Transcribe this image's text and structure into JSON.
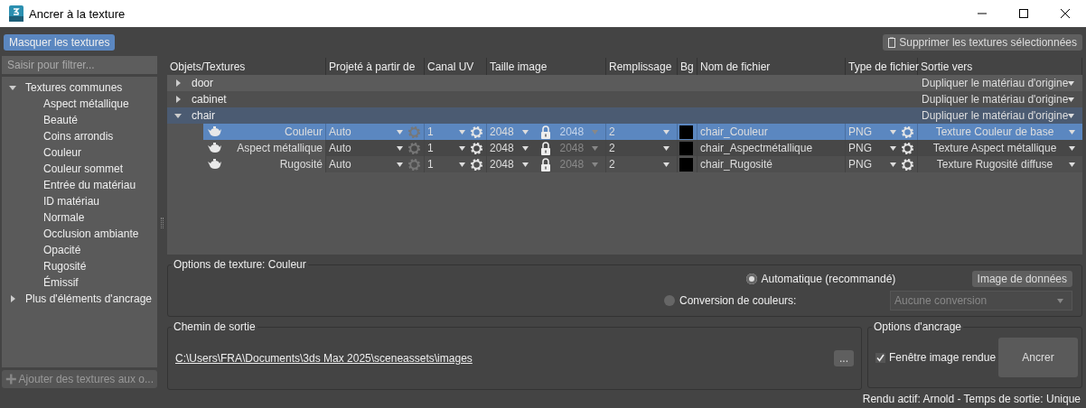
{
  "window": {
    "title": "Ancrer à la texture"
  },
  "toolbar": {
    "hide_button": "Masquer les textures",
    "remove_button": "Supprimer les textures sélectionnées"
  },
  "sidebar": {
    "filter_placeholder": "Saisir pour filtrer...",
    "tree": [
      {
        "label": "Textures communes",
        "expanded": true,
        "children": [
          {
            "label": "Aspect métallique"
          },
          {
            "label": "Beauté"
          },
          {
            "label": "Coins arrondis"
          },
          {
            "label": "Couleur"
          },
          {
            "label": "Couleur sommet"
          },
          {
            "label": "Entrée du matériau"
          },
          {
            "label": "ID matériau"
          },
          {
            "label": "Normale"
          },
          {
            "label": "Occlusion ambiante"
          },
          {
            "label": "Opacité"
          },
          {
            "label": "Rugosité"
          },
          {
            "label": "Émissif"
          }
        ]
      },
      {
        "label": "Plus d'éléments d'ancrage",
        "expanded": false
      }
    ],
    "add_button": {
      "label": "Ajouter des textures aux o...",
      "disabled": true
    }
  },
  "table": {
    "columns": [
      "Objets/Textures",
      "Projeté à partir de",
      "Canal UV",
      "Taille image",
      "Remplissage",
      "Bg",
      "Nom de fichier",
      "Type de fichier",
      "Sortie vers"
    ],
    "rows": [
      {
        "name": "door",
        "expanded": false,
        "selected": false,
        "output": "Dupliquer le matériau d'origine",
        "children": []
      },
      {
        "name": "cabinet",
        "expanded": false,
        "selected": false,
        "output": "Dupliquer le matériau d'origine",
        "children": []
      },
      {
        "name": "chair",
        "expanded": true,
        "selected": true,
        "output": "Dupliquer le matériau d'origine",
        "children": [
          {
            "name": "Couleur",
            "selected": true,
            "projected": "Auto",
            "uv": "1",
            "size": "2048",
            "size_locked": "2048",
            "fill": "2",
            "color": "#000000",
            "filename": "chair_Couleur",
            "filetype": "PNG",
            "output": "Texture Couleur de base"
          },
          {
            "name": "Aspect métallique",
            "selected": false,
            "projected": "Auto",
            "uv": "1",
            "size": "2048",
            "size_locked": "2048",
            "fill": "2",
            "color": "#000000",
            "filename": "chair_Aspectmétallique",
            "filetype": "PNG",
            "output": "Texture Aspect métallique"
          },
          {
            "name": "Rugosité",
            "selected": false,
            "projected": "Auto",
            "uv": "1",
            "size": "2048",
            "size_locked": "2048",
            "fill": "2",
            "color": "#000000",
            "filename": "chair_Rugosité",
            "filetype": "PNG",
            "output": "Texture Rugosité diffuse"
          }
        ]
      }
    ]
  },
  "texture_options": {
    "title": "Options de texture: Couleur",
    "radios": [
      {
        "label": "Automatique (recommandé)",
        "selected": true
      },
      {
        "label": "Conversion de couleurs:",
        "selected": false
      }
    ],
    "data_button": "Image de données",
    "conversion": {
      "value": "Aucune conversion",
      "disabled": true
    }
  },
  "output_path": {
    "title": "Chemin de sortie",
    "path": "C:\\Users\\FRA\\Documents\\3ds Max 2025\\sceneassets\\images",
    "browse": "..."
  },
  "bake_options": {
    "title": "Options d'ancrage",
    "checkbox": {
      "label": "Fenêtre image rendue",
      "checked": true
    },
    "bake_button": "Ancrer"
  },
  "status_bar": "Rendu actif: Arnold - Temps de sortie: Unique"
}
